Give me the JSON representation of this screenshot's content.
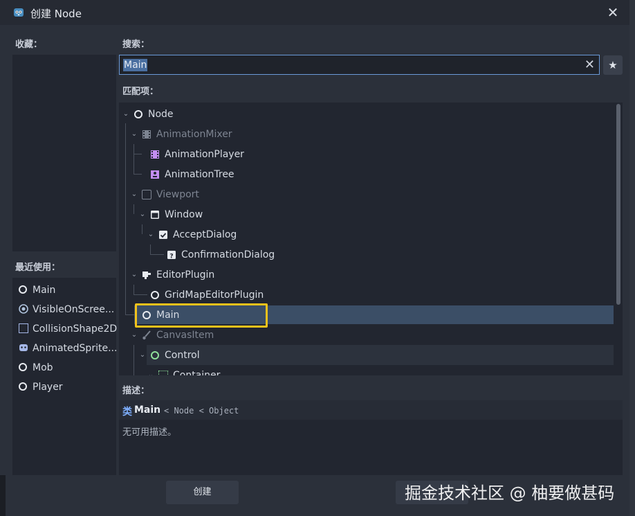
{
  "window": {
    "title": "创建 Node",
    "close": "✕"
  },
  "favorites": {
    "label": "收藏："
  },
  "recent": {
    "label": "最近使用：",
    "items": [
      {
        "label": "Main"
      },
      {
        "label": "VisibleOnScree..."
      },
      {
        "label": "CollisionShape2D"
      },
      {
        "label": "AnimatedSprite..."
      },
      {
        "label": "Mob"
      },
      {
        "label": "Player"
      }
    ]
  },
  "search": {
    "label": "搜索：",
    "value": "Main",
    "clear": "✕",
    "favorite": "★"
  },
  "matches": {
    "label": "匹配项：",
    "tree": [
      {
        "label": "Node"
      },
      {
        "label": "AnimationMixer"
      },
      {
        "label": "AnimationPlayer"
      },
      {
        "label": "AnimationTree"
      },
      {
        "label": "Viewport"
      },
      {
        "label": "Window"
      },
      {
        "label": "AcceptDialog"
      },
      {
        "label": "ConfirmationDialog"
      },
      {
        "label": "EditorPlugin"
      },
      {
        "label": "GridMapEditorPlugin"
      },
      {
        "label": "Main"
      },
      {
        "label": "CanvasItem"
      },
      {
        "label": "Control"
      },
      {
        "label": "Container"
      }
    ]
  },
  "description": {
    "label": "描述：",
    "class_prefix": "类",
    "class_name": "Main",
    "inheritance": "< Node < Object",
    "text": "无可用描述。"
  },
  "buttons": {
    "create": "创建"
  },
  "watermark": "掘金技术社区 @ 柚要做甚码",
  "colors": {
    "highlight": "#f2c21b",
    "accent": "#6b9ad8",
    "selection": "#3b4e66"
  }
}
